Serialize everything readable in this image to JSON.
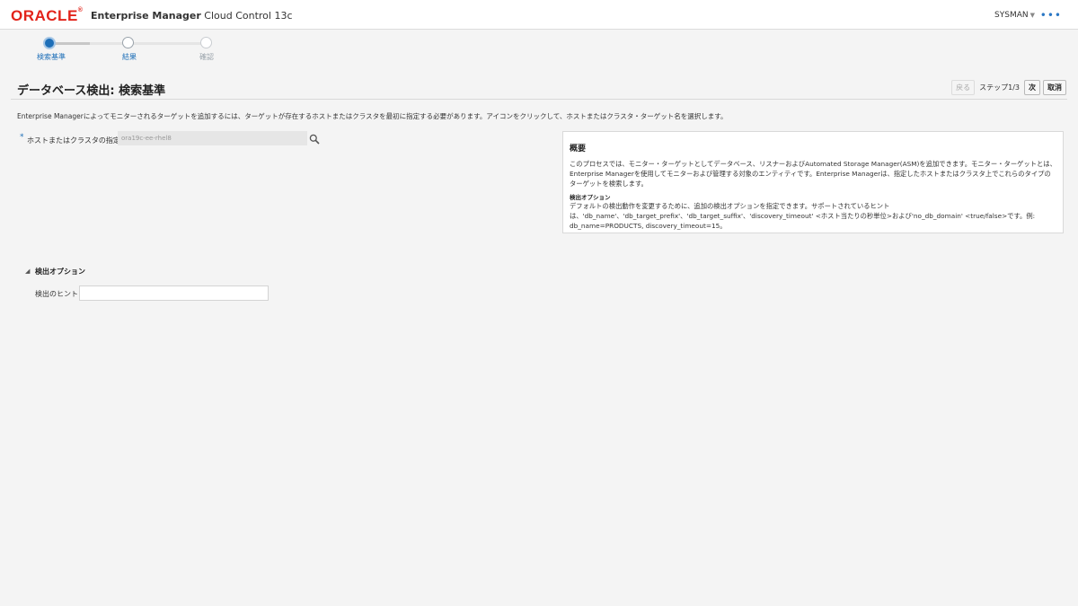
{
  "header": {
    "logo": "ORACLE",
    "product_bold": "Enterprise Manager",
    "product_rest": "Cloud Control 13c",
    "user": "SYSMAN",
    "more_icon": "ellipsis-icon"
  },
  "train": {
    "steps": [
      {
        "label": "検索基準",
        "state": "active"
      },
      {
        "label": "結果",
        "state": "pending"
      },
      {
        "label": "確認",
        "state": "disabled"
      }
    ]
  },
  "page": {
    "title": "データベース検出: 検索基準",
    "back_label": "戻る",
    "step_text": "ステップ1/3",
    "next_label": "次",
    "cancel_label": "取消",
    "description": "Enterprise Managerによってモニターされるターゲットを追加するには、ターゲットが存在するホストまたはクラスタを最初に指定する必要があります。アイコンをクリックして、ホストまたはクラスタ・ターゲット名を選択します。"
  },
  "host": {
    "label": "ホストまたはクラスタの指定",
    "value": "ora19c-ee-rhel8",
    "required_mark": "*"
  },
  "info": {
    "title": "概要",
    "body": "このプロセスでは、モニター・ターゲットとしてデータベース、リスナーおよびAutomated Storage Manager(ASM)を追加できます。モニター・ターゲットとは、Enterprise Managerを使用してモニターおよび管理する対象のエンティティです。Enterprise Managerは、指定したホストまたはクラスタ上でこれらのタイプのターゲットを検索します。",
    "options_heading": "検出オプション",
    "options_body": "デフォルトの検出動作を変更するために、追加の検出オプションを指定できます。サポートされているヒントは、'db_name'、'db_target_prefix'、'db_target_suffix'、'discovery_timeout' <ホスト当たりの秒単位>および'no_db_domain' <true/false>です。例: db_name=PRODUCTS, discovery_timeout=15。"
  },
  "options": {
    "toggle_glyph": "◢",
    "title": "検出オプション",
    "hint_label": "検出のヒント",
    "hint_value": ""
  },
  "colors": {
    "brand_red": "#e2231a",
    "accent_blue": "#1e6fb8"
  }
}
